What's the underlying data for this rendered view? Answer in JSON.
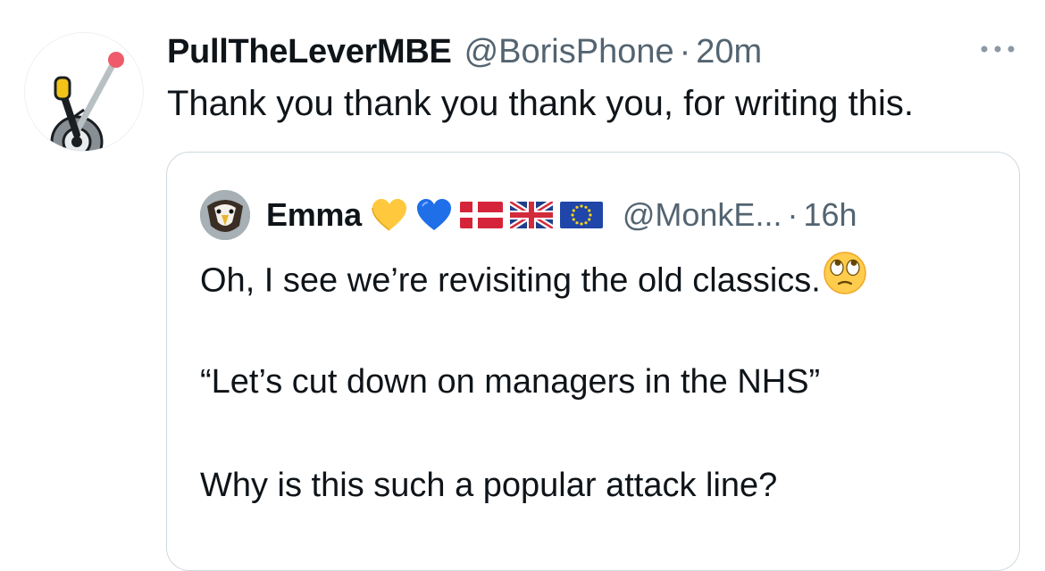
{
  "tweet": {
    "avatar_icon": "lever-icon",
    "display_name": "PullTheLeverMBE",
    "handle": "@BorisPhone",
    "separator": "·",
    "time": "20m",
    "text": "Thank you thank you thank you, for writing this.",
    "more_icon": "more-dots-icon"
  },
  "quote": {
    "display_name": "Emma",
    "name_emojis": [
      "yellow-heart-icon",
      "blue-heart-icon",
      "denmark-flag-icon",
      "uk-flag-icon",
      "eu-flag-icon"
    ],
    "handle": "@MonkE...",
    "separator": "·",
    "time": "16h",
    "line1": "Oh, I see we’re revisiting the old classics.",
    "line1_emoji": "eye-roll-emoji-icon",
    "line2": "“Let’s cut down on managers in the NHS”",
    "line3": "Why is this such a popular attack line?"
  },
  "colors": {
    "text": "#0f1419",
    "secondary": "#536471",
    "border": "#cfd9de"
  }
}
